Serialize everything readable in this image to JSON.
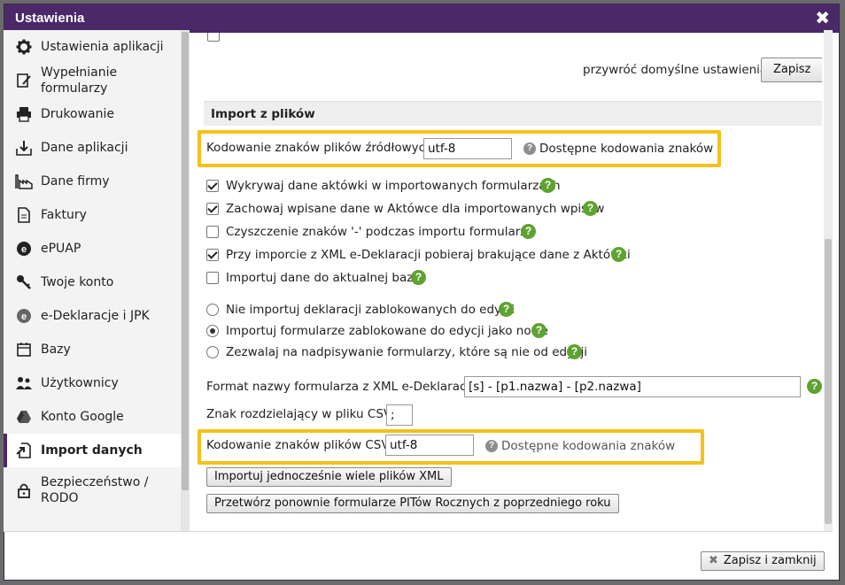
{
  "window": {
    "title": "Ustawienia",
    "close": "✖"
  },
  "sidebar": {
    "items": [
      {
        "label": "Ustawienia aplikacji",
        "icon": "gear-icon"
      },
      {
        "label": "Wypełnianie formularzy",
        "icon": "edit-form-icon"
      },
      {
        "label": "Drukowanie",
        "icon": "printer-icon"
      },
      {
        "label": "Dane aplikacji",
        "icon": "download-tray-icon"
      },
      {
        "label": "Dane firmy",
        "icon": "factory-icon"
      },
      {
        "label": "Faktury",
        "icon": "document-icon"
      },
      {
        "label": "ePUAP",
        "icon": "epuap-icon"
      },
      {
        "label": "Twoje konto",
        "icon": "key-icon"
      },
      {
        "label": "e-Deklaracje i JPK",
        "icon": "edeklaracje-icon"
      },
      {
        "label": "Bazy",
        "icon": "database-icon"
      },
      {
        "label": "Użytkownicy",
        "icon": "users-icon"
      },
      {
        "label": "Konto Google",
        "icon": "google-drive-icon"
      },
      {
        "label": "Import danych",
        "icon": "import-icon"
      },
      {
        "label": "Bezpieczeństwo / RODO",
        "icon": "lock-icon"
      }
    ]
  },
  "top": {
    "restore_defaults": "przywróć domyślne ustawienia",
    "save_label": "Zapisz"
  },
  "section": {
    "title": "Import z plików",
    "source_encoding_label": "Kodowanie znaków plików źródłowych",
    "source_encoding_value": "utf-8",
    "available_encodings": "Dostępne kodowania znaków",
    "checkboxes": [
      {
        "label": "Wykrywaj dane aktówki w importowanych formularzach",
        "checked": true
      },
      {
        "label": "Zachowaj wpisane dane w Aktówce dla importowanych wpisów",
        "checked": true
      },
      {
        "label": "Czyszczenie znaków '-' podczas importu formularzy",
        "checked": false
      },
      {
        "label": "Przy imporcie z XML e-Deklaracji pobieraj brakujące dane z Aktówki",
        "checked": true
      },
      {
        "label": "Importuj dane do aktualnej bazy",
        "checked": false
      }
    ],
    "radios": [
      {
        "label": "Nie importuj deklaracji zablokowanych do edycji",
        "checked": false
      },
      {
        "label": "Importuj formularze zablokowane do edycji jako nowe",
        "checked": true
      },
      {
        "label": "Zezwalaj na nadpisywanie formularzy, które są nie od edycji",
        "checked": false
      }
    ],
    "xml_format_label": "Format nazwy formularza z XML e-Deklaracji",
    "xml_format_value": "[s] - [p1.nazwa] - [p2.nazwa]",
    "csv_separator_label": "Znak rozdzielający w pliku CSV",
    "csv_separator_value": ";",
    "csv_encoding_label": "Kodowanie znaków plików CSV",
    "csv_encoding_value": "utf-8",
    "csv_available_encodings": "Dostępne kodowania znaków",
    "import_many_xml": "Importuj jednocześnie wiele plików XML",
    "reprocess_pit": "Przetwórz ponownie formularze PITów Rocznych z poprzedniego roku"
  },
  "footer": {
    "save_close": "Zapisz i zamknij",
    "save_close_icon": "✖"
  },
  "colors": {
    "titlebar": "#4b2868",
    "highlight": "#f2c21b",
    "help_green": "#5ea32f"
  }
}
